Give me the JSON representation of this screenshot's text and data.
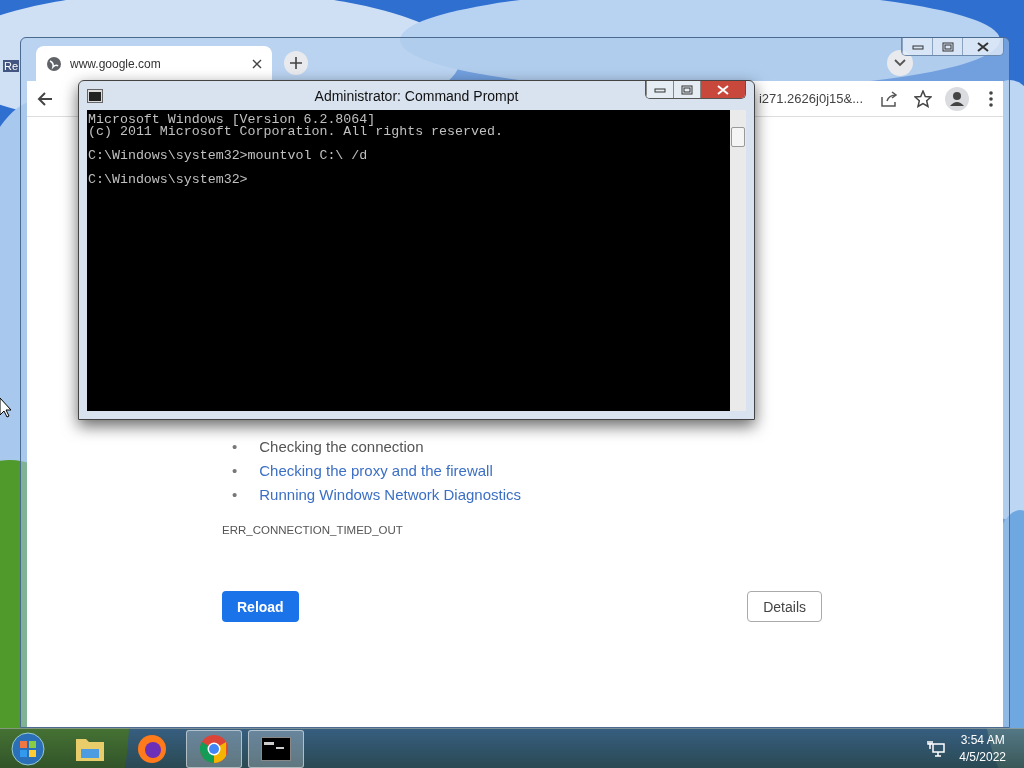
{
  "desktop": {
    "icon_label": "Re"
  },
  "browser": {
    "tab": {
      "title": "www.google.com",
      "selected": true
    },
    "address": "i271.2626j0j15&...",
    "content": {
      "suggestions": [
        {
          "marker": "•",
          "text": "Checking the connection",
          "link": false
        },
        {
          "marker": "•",
          "text": "Checking the proxy and the firewall",
          "link": true
        },
        {
          "marker": "•",
          "text": "Running Windows Network Diagnostics",
          "link": true
        }
      ],
      "error_code": "ERR_CONNECTION_TIMED_OUT",
      "buttons": [
        {
          "label": "Reload",
          "kind": "primary"
        },
        {
          "label": "Details",
          "kind": "secondary"
        }
      ]
    }
  },
  "console": {
    "title": "Administrator: Command Prompt",
    "blocks": [
      [
        "Microsoft Windows [Version 6.2.8064]",
        "(c) 2011 Microsoft Corporation. All rights reserved."
      ],
      [
        "C:\\Windows\\system32>mountvol C:\\ /d"
      ],
      [
        "C:\\Windows\\system32>"
      ]
    ]
  },
  "taskbar": {
    "items": [
      {
        "kind": "start",
        "running": false
      },
      {
        "kind": "explorer",
        "running": false
      },
      {
        "kind": "firefox",
        "running": false
      },
      {
        "kind": "chrome",
        "running": true
      },
      {
        "kind": "console",
        "running": true
      }
    ],
    "time": "3:54 AM",
    "date": "4/5/2022"
  }
}
